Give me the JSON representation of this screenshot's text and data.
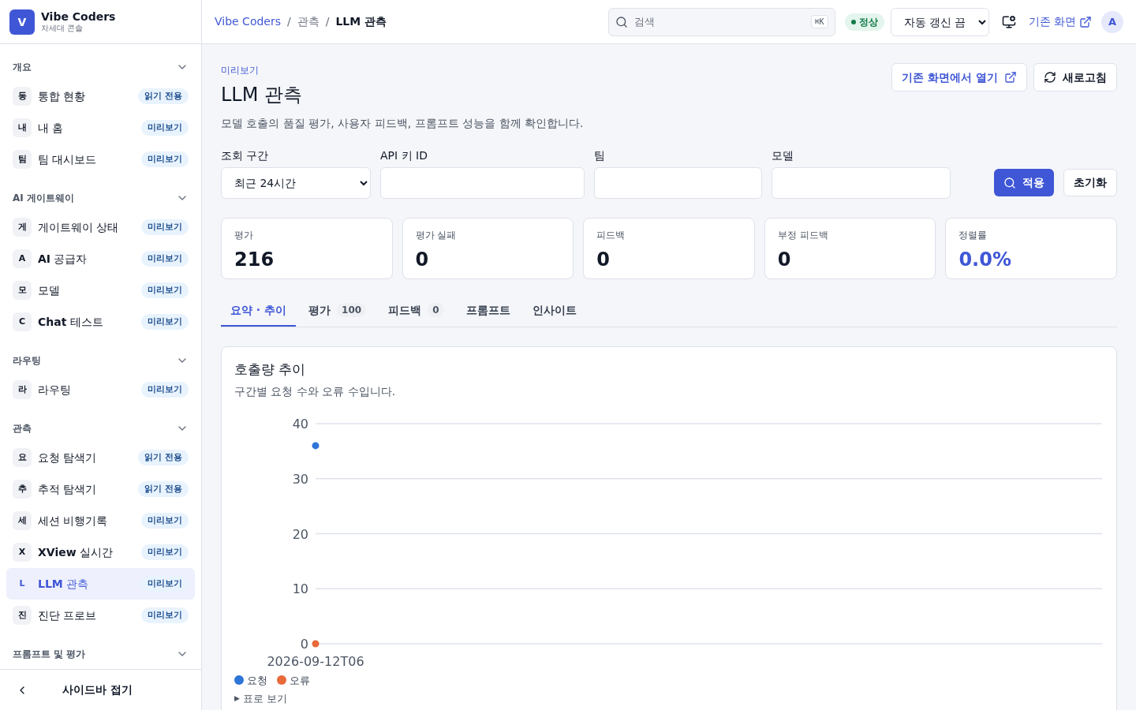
{
  "brand": {
    "logo": "V",
    "name": "Vibe Coders",
    "subtitle": "차세대 콘솔"
  },
  "sidebar": {
    "sections": [
      {
        "title": "개요",
        "expanded": true,
        "items": [
          {
            "tile": "동",
            "label": "통합 현황",
            "badge": "읽기 전용",
            "selected": false
          },
          {
            "tile": "내",
            "label": "내 홈",
            "badge": "미리보기",
            "selected": false
          },
          {
            "tile": "팀",
            "label": "팀 대시보드",
            "badge": "미리보기",
            "selected": false
          }
        ]
      },
      {
        "title": "AI 게이트웨이",
        "expanded": true,
        "items": [
          {
            "tile": "게",
            "label": "게이트웨이 상태",
            "badge": "미리보기",
            "selected": false
          },
          {
            "tile": "A",
            "label": "**AI** 공급자",
            "badge": "미리보기",
            "selected": false
          },
          {
            "tile": "모",
            "label": "모델",
            "badge": "미리보기",
            "selected": false
          },
          {
            "tile": "C",
            "label": "**Chat** 테스트",
            "badge": "미리보기",
            "selected": false
          }
        ]
      },
      {
        "title": "라우팅",
        "expanded": true,
        "items": [
          {
            "tile": "라",
            "label": "라우팅",
            "badge": "미리보기",
            "selected": false
          }
        ]
      },
      {
        "title": "관측",
        "expanded": true,
        "items": [
          {
            "tile": "요",
            "label": "요청 탐색기",
            "badge": "읽기 전용",
            "selected": false
          },
          {
            "tile": "추",
            "label": "추적 탐색기",
            "badge": "읽기 전용",
            "selected": false
          },
          {
            "tile": "세",
            "label": "세션 비행기록",
            "badge": "미리보기",
            "selected": false
          },
          {
            "tile": "X",
            "label": "**XView** 실시간",
            "badge": "미리보기",
            "selected": false
          },
          {
            "tile": "L",
            "label": "**LLM** 관측",
            "badge": "미리보기",
            "selected": true
          },
          {
            "tile": "진",
            "label": "진단 프로브",
            "badge": "미리보기",
            "selected": false
          }
        ]
      },
      {
        "title": "프롬프트 및 평가",
        "expanded": true
      }
    ],
    "collapse": {
      "label": "사이드바 접기"
    }
  },
  "topbar": {
    "breadcrumbs": [
      "Vibe Coders",
      "관측",
      "LLM 관측"
    ],
    "breadcrumb_separator": "/",
    "search": {
      "placeholder": "검색",
      "shortcut": "⌘K"
    },
    "status": "정상",
    "refresh_select": "자동 갱신 끔",
    "legacy_link": "기존 화면",
    "avatar": "A"
  },
  "page": {
    "eyebrow": "미리보기",
    "title": "LLM 관측",
    "description": "모델 호출의 품질 평가, 사용자 피드백, 프롬프트 성능을 함께 확인합니다.",
    "open_legacy_button": "기존 화면에서 열기",
    "refresh_button": "새로고침"
  },
  "filters": {
    "fields": [
      {
        "kind": "select",
        "label": "조회 구간",
        "value": "최근 24시간"
      },
      {
        "kind": "input",
        "label": "API 키 ID"
      },
      {
        "kind": "input",
        "label": "팀"
      },
      {
        "kind": "input",
        "label": "모델"
      }
    ],
    "apply_button": "적용",
    "reset_button": "초기화"
  },
  "stats": [
    {
      "label": "평가",
      "value": "216",
      "accent": false
    },
    {
      "label": "평가 실패",
      "value": "0",
      "accent": false
    },
    {
      "label": "피드백",
      "value": "0",
      "accent": false
    },
    {
      "label": "부정 피드백",
      "value": "0",
      "accent": false
    },
    {
      "label": "정렬률",
      "value": "0.0%",
      "accent": true
    }
  ],
  "tabs": [
    {
      "label": "요약 · 추이",
      "selected": true
    },
    {
      "label": "평가",
      "count": "100",
      "selected": false
    },
    {
      "label": "피드백",
      "count": "0",
      "selected": false
    },
    {
      "label": "프롬프트",
      "selected": false
    },
    {
      "label": "인사이트",
      "selected": false
    }
  ],
  "chart_card": {
    "title": "호출량 추이",
    "subtitle": "구간별 요청 수와 오류 수입니다.",
    "chart_data": {
      "type": "scatter",
      "x": [
        "2026-09-12T06"
      ],
      "series": [
        {
          "name": "요청",
          "color": "#2f74d8",
          "values": [
            36
          ]
        },
        {
          "name": "오류",
          "color": "#e8693a",
          "values": [
            0
          ]
        }
      ],
      "ylim": [
        0,
        40
      ],
      "yticks": [
        0,
        10,
        20,
        30,
        40
      ],
      "grid": true,
      "legend": "bottom-left"
    },
    "table_toggle": {
      "marker": "▶",
      "label": "표로 보기"
    }
  }
}
